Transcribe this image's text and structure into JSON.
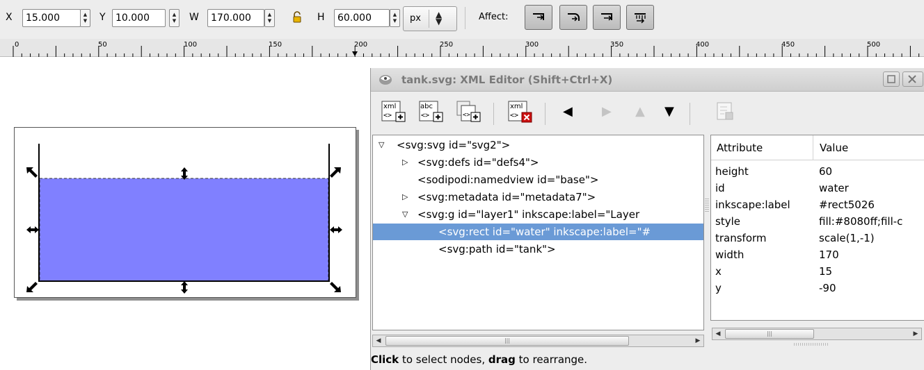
{
  "toolbar": {
    "x_label": "X",
    "x_value": "15.000",
    "y_label": "Y",
    "y_value": "10.000",
    "w_label": "W",
    "w_value": "170.000",
    "h_label": "H",
    "h_value": "60.000",
    "unit": "px",
    "affect_label": "Affect:"
  },
  "ruler": {
    "labels": [
      "0",
      "50",
      "100",
      "150",
      "200",
      "250",
      "300",
      "350",
      "400",
      "450",
      "500"
    ]
  },
  "canvas": {
    "fill_color": "#8080ff",
    "stroke_color": "#000000"
  },
  "xml_editor": {
    "title": "tank.svg: XML Editor (Shift+Ctrl+X)",
    "tree": [
      {
        "text": "<svg:svg id=\"svg2\">",
        "expander": "open"
      },
      {
        "text": "<svg:defs id=\"defs4\">",
        "expander": "closed"
      },
      {
        "text": "<sodipodi:namedview id=\"base\">",
        "expander": "none"
      },
      {
        "text": "<svg:metadata id=\"metadata7\">",
        "expander": "closed"
      },
      {
        "text": "<svg:g id=\"layer1\" inkscape:label=\"Layer",
        "expander": "open"
      },
      {
        "text": "<svg:rect id=\"water\" inkscape:label=\"#",
        "expander": "none",
        "selected": true
      },
      {
        "text": "<svg:path id=\"tank\">",
        "expander": "none"
      }
    ],
    "attr_header": {
      "attribute": "Attribute",
      "value": "Value"
    },
    "attributes": [
      {
        "name": "height",
        "value": "60"
      },
      {
        "name": "id",
        "value": "water"
      },
      {
        "name": "inkscape:label",
        "value": "#rect5026"
      },
      {
        "name": "style",
        "value": "fill:#8080ff;fill-c"
      },
      {
        "name": "transform",
        "value": "scale(1,-1)"
      },
      {
        "name": "width",
        "value": "170"
      },
      {
        "name": "x",
        "value": "15"
      },
      {
        "name": "y",
        "value": "-90"
      }
    ],
    "status": {
      "bold1": "Click",
      "text1": " to select nodes, ",
      "bold2": "drag",
      "text2": " to rearrange."
    },
    "selection_color": "#6a9ad6"
  }
}
